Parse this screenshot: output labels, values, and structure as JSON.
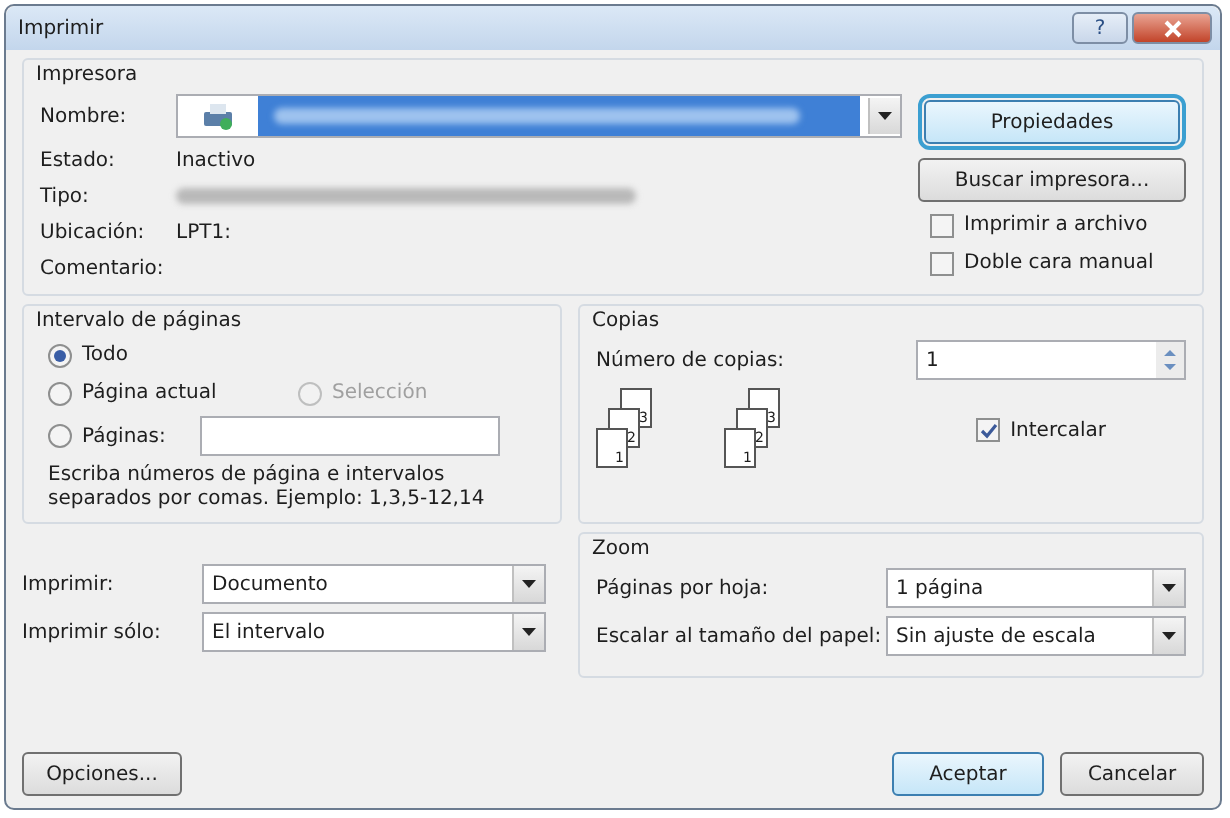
{
  "window": {
    "title": "Imprimir",
    "help": "?"
  },
  "printer": {
    "legend": "Impresora",
    "name_label": "Nombre:",
    "status_label": "Estado:",
    "status": "Inactivo",
    "type_label": "Tipo:",
    "location_label": "Ubicación:",
    "location": "LPT1:",
    "comment_label": "Comentario:",
    "properties_button": "Propiedades",
    "find_button": "Buscar impresora...",
    "options": [
      {
        "label": "Imprimir a archivo",
        "checked": false
      },
      {
        "label": "Doble cara manual",
        "checked": false
      }
    ]
  },
  "page_range": {
    "legend": "Intervalo de páginas",
    "options": [
      {
        "label": "Todo",
        "selected": true,
        "disabled": false
      },
      {
        "label": "Página actual",
        "selected": false,
        "disabled": false
      },
      {
        "label": "Selección",
        "selected": false,
        "disabled": true
      },
      {
        "label": "Páginas:",
        "selected": false,
        "disabled": false
      }
    ],
    "hint": "Escriba números de página e intervalos separados por comas. Ejemplo: 1,3,5-12,14"
  },
  "copies": {
    "legend": "Copias",
    "count_label": "Número de copias:",
    "count": "1",
    "stacks": [
      [
        "1",
        "2",
        "3"
      ],
      [
        "1",
        "2",
        "3"
      ]
    ],
    "collate": {
      "label": "Intercalar",
      "checked": true
    }
  },
  "print_what": [
    {
      "label": "Imprimir:",
      "value": "Documento"
    },
    {
      "label": "Imprimir sólo:",
      "value": "El intervalo"
    }
  ],
  "zoom": {
    "legend": "Zoom",
    "rows": [
      {
        "label": "Páginas por hoja:",
        "value": "1 página"
      },
      {
        "label": "Escalar al tamaño del papel:",
        "value": "Sin ajuste de escala"
      }
    ]
  },
  "buttons": {
    "options": "Opciones...",
    "ok": "Aceptar",
    "cancel": "Cancelar"
  }
}
